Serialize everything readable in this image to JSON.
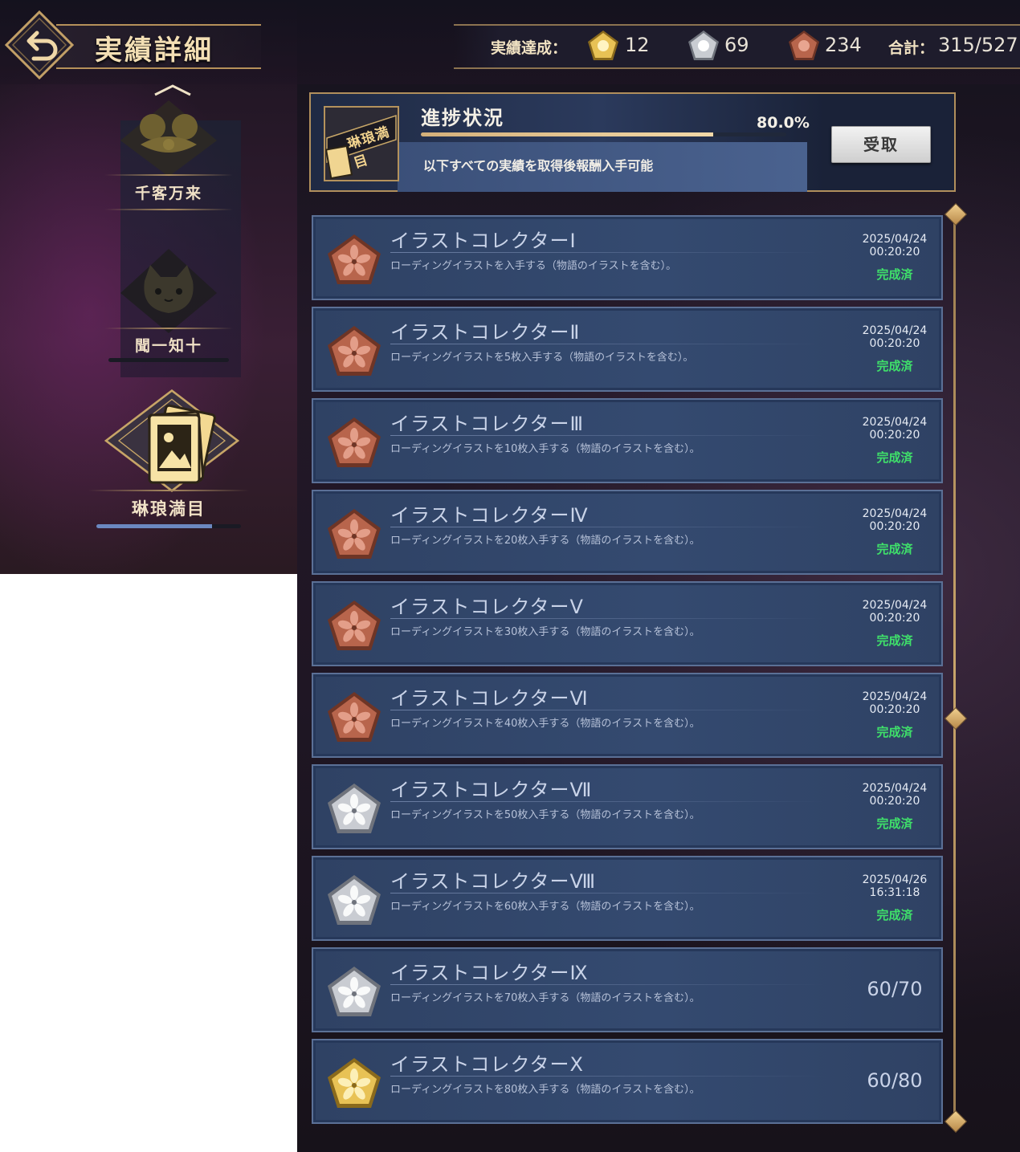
{
  "header": {
    "title": "実績詳細",
    "stats_label": "実績達成：",
    "gold_count": "12",
    "silver_count": "69",
    "bronze_count": "234",
    "total_label": "合計：",
    "total_value": "315/527"
  },
  "sidebar": {
    "items": [
      {
        "label": "千客万来",
        "icon": "bell-ribbon-icon"
      },
      {
        "label": "聞一知十",
        "icon": "cat-icon"
      },
      {
        "label": "琳琅満目",
        "icon": "picture-cards-icon",
        "progress": 0.8
      }
    ]
  },
  "progress_panel": {
    "title": "進捗状況",
    "percent": "80.0%",
    "progress": 0.8,
    "description": "以下すべての実績を取得後報酬入手可能",
    "claim_label": "受取",
    "badge_text": "琳琅満目"
  },
  "achievements": [
    {
      "title": "イラストコレクターⅠ",
      "desc": "ローディングイラストを入手する（物語のイラストを含む）。",
      "medal": "bronze",
      "date": "2025/04/24",
      "time": "00:20:20",
      "status": "完成済"
    },
    {
      "title": "イラストコレクターⅡ",
      "desc": "ローディングイラストを5枚入手する（物語のイラストを含む）。",
      "medal": "bronze",
      "date": "2025/04/24",
      "time": "00:20:20",
      "status": "完成済"
    },
    {
      "title": "イラストコレクターⅢ",
      "desc": "ローディングイラストを10枚入手する（物語のイラストを含む）。",
      "medal": "bronze",
      "date": "2025/04/24",
      "time": "00:20:20",
      "status": "完成済"
    },
    {
      "title": "イラストコレクターⅣ",
      "desc": "ローディングイラストを20枚入手する（物語のイラストを含む）。",
      "medal": "bronze",
      "date": "2025/04/24",
      "time": "00:20:20",
      "status": "完成済"
    },
    {
      "title": "イラストコレクターⅤ",
      "desc": "ローディングイラストを30枚入手する（物語のイラストを含む）。",
      "medal": "bronze",
      "date": "2025/04/24",
      "time": "00:20:20",
      "status": "完成済"
    },
    {
      "title": "イラストコレクターⅥ",
      "desc": "ローディングイラストを40枚入手する（物語のイラストを含む）。",
      "medal": "bronze",
      "date": "2025/04/24",
      "time": "00:20:20",
      "status": "完成済"
    },
    {
      "title": "イラストコレクターⅦ",
      "desc": "ローディングイラストを50枚入手する（物語のイラストを含む）。",
      "medal": "silver",
      "date": "2025/04/24",
      "time": "00:20:20",
      "status": "完成済"
    },
    {
      "title": "イラストコレクターⅧ",
      "desc": "ローディングイラストを60枚入手する（物語のイラストを含む）。",
      "medal": "silver",
      "date": "2025/04/26",
      "time": "16:31:18",
      "status": "完成済"
    },
    {
      "title": "イラストコレクターⅨ",
      "desc": "ローディングイラストを70枚入手する（物語のイラストを含む）。",
      "medal": "silver",
      "count": "60/70"
    },
    {
      "title": "イラストコレクターⅩ",
      "desc": "ローディングイラストを80枚入手する（物語のイラストを含む）。",
      "medal": "gold",
      "count": "60/80"
    }
  ],
  "colors": {
    "gold": "#e8c255",
    "silver": "#c9ccd2",
    "bronze": "#b8654c",
    "complete": "#3fe06a",
    "frame": "#b18f5c"
  }
}
